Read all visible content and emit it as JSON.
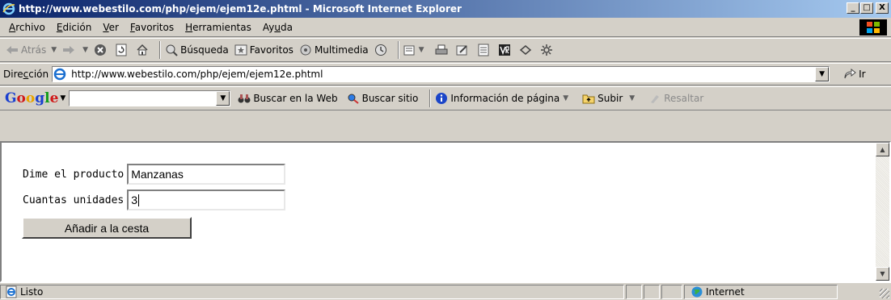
{
  "window": {
    "title": "http://www.webestilo.com/php/ejem/ejem12e.phtml - Microsoft Internet Explorer",
    "minimize": "_",
    "maximize": "□",
    "close": "X"
  },
  "menu": [
    {
      "pre": "",
      "u": "A",
      "post": "rchivo"
    },
    {
      "pre": "",
      "u": "E",
      "post": "dición"
    },
    {
      "pre": "",
      "u": "V",
      "post": "er"
    },
    {
      "pre": "",
      "u": "F",
      "post": "avoritos"
    },
    {
      "pre": "",
      "u": "H",
      "post": "erramientas"
    },
    {
      "pre": "Ay",
      "u": "u",
      "post": "da"
    }
  ],
  "toolbar": {
    "back": "Atrás",
    "search": "Búsqueda",
    "favorites": "Favoritos",
    "media": "Multimedia"
  },
  "address": {
    "label_pre": "Dire",
    "label_u": "c",
    "label_post": "ción",
    "url": "http://www.webestilo.com/php/ejem/ejem12e.phtml",
    "go": "Ir"
  },
  "google": {
    "logo": [
      "G",
      "o",
      "o",
      "g",
      "l",
      "e"
    ],
    "search_web": "Buscar en la Web",
    "search_site": "Buscar sitio",
    "page_info": "Información de página",
    "up": "Subir",
    "highlight": "Resaltar"
  },
  "form": {
    "product_label": "Dime el producto",
    "product_value": "Manzanas",
    "units_label": "Cuantas unidades",
    "units_value": "3",
    "submit_label": "Añadir a la cesta"
  },
  "status": {
    "text": "Listo",
    "zone": "Internet"
  },
  "colors": {
    "title_gradient_start": "#0a246a",
    "title_gradient_end": "#a6caf0",
    "chrome": "#d4d0c8"
  }
}
